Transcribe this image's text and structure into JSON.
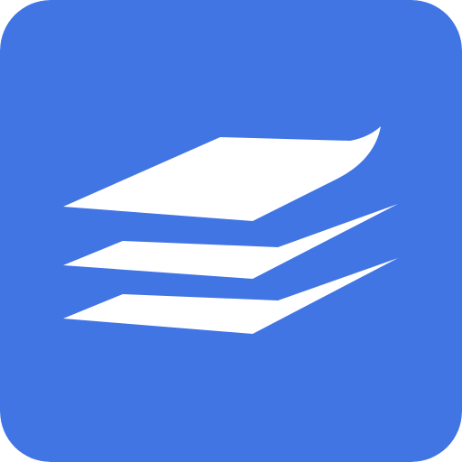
{
  "app_icon": {
    "name": "paper-stack-icon",
    "background_color": "#4175E4",
    "glyph_color": "#FFFFFF"
  }
}
